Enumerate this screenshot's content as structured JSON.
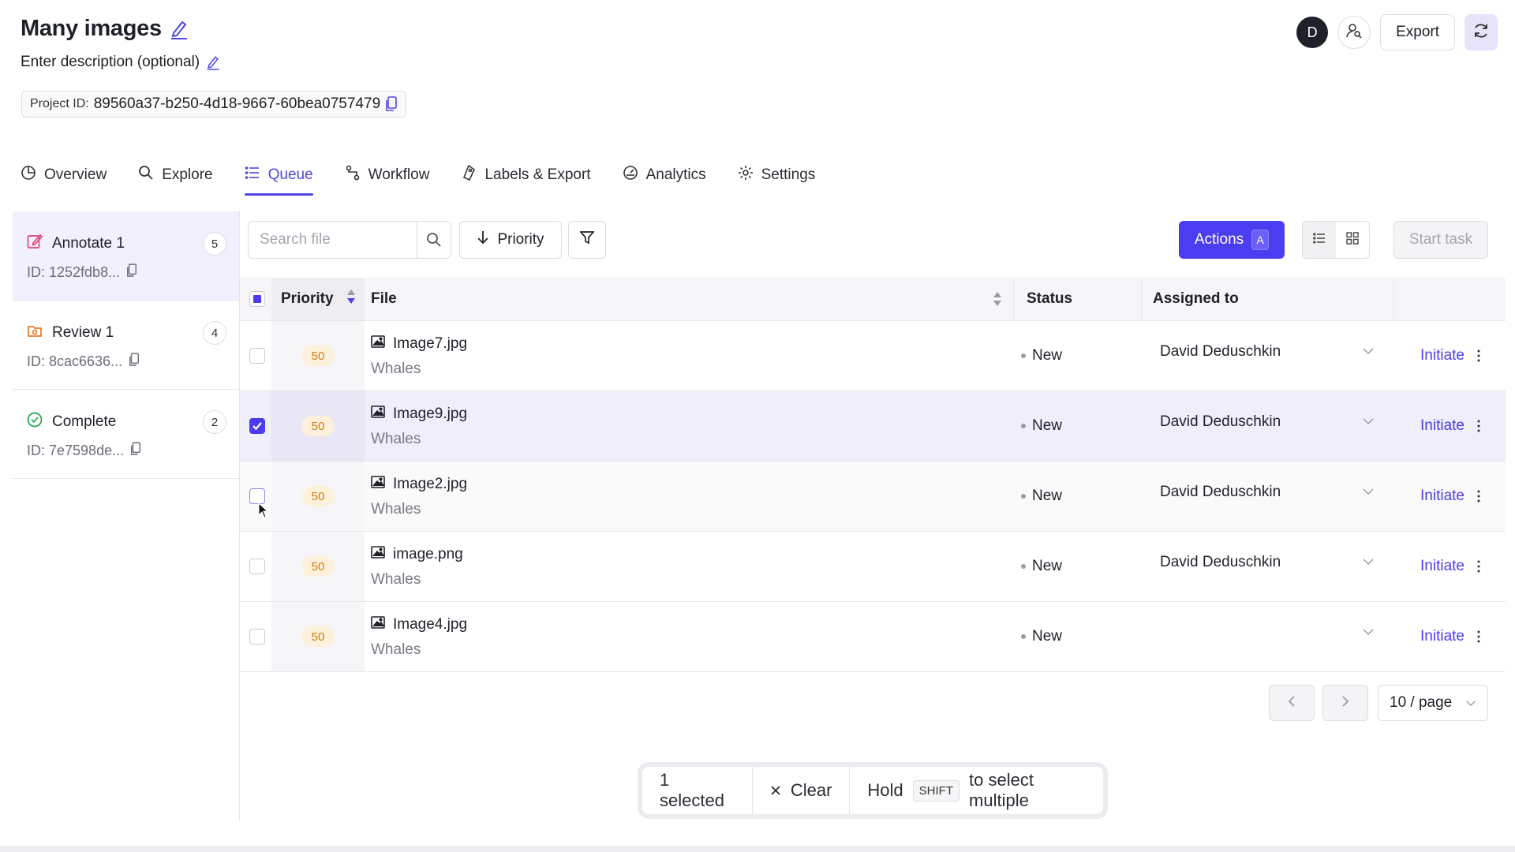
{
  "header": {
    "title": "Many images",
    "description": "Enter description (optional)",
    "project_id_label": "Project ID:",
    "project_id": "89560a37-b250-4d18-9667-60bea0757479",
    "avatar_initial": "D",
    "export_label": "Export"
  },
  "tabs": [
    {
      "label": "Overview",
      "icon": "overview-icon"
    },
    {
      "label": "Explore",
      "icon": "search-icon"
    },
    {
      "label": "Queue",
      "icon": "list-icon",
      "active": true
    },
    {
      "label": "Workflow",
      "icon": "workflow-icon"
    },
    {
      "label": "Labels & Export",
      "icon": "tag-icon"
    },
    {
      "label": "Analytics",
      "icon": "gauge-icon"
    },
    {
      "label": "Settings",
      "icon": "gear-icon"
    }
  ],
  "stages": [
    {
      "name": "Annotate 1",
      "id": "ID: 1252fdb8...",
      "count": "5",
      "icon": "edit-icon",
      "color": "#e0457b"
    },
    {
      "name": "Review 1",
      "id": "ID: 8cac6636...",
      "count": "4",
      "icon": "review-icon",
      "color": "#e07b2a"
    },
    {
      "name": "Complete",
      "id": "ID: 7e7598de...",
      "count": "2",
      "icon": "check-circle-icon",
      "color": "#2aa04a"
    }
  ],
  "toolbar": {
    "search_placeholder": "Search file",
    "sort_label": "Priority",
    "actions_label": "Actions",
    "actions_shortcut": "A",
    "start_task_label": "Start task"
  },
  "table": {
    "columns": {
      "priority": "Priority",
      "file": "File",
      "status": "Status",
      "assigned": "Assigned to"
    },
    "rows": [
      {
        "priority": "50",
        "file": "Image7.jpg",
        "dataset": "Whales",
        "status": "New",
        "assignee": "David Deduschkin",
        "action": "Initiate",
        "selected": false
      },
      {
        "priority": "50",
        "file": "Image9.jpg",
        "dataset": "Whales",
        "status": "New",
        "assignee": "David Deduschkin",
        "action": "Initiate",
        "selected": true
      },
      {
        "priority": "50",
        "file": "Image2.jpg",
        "dataset": "Whales",
        "status": "New",
        "assignee": "David Deduschkin",
        "action": "Initiate",
        "selected": false
      },
      {
        "priority": "50",
        "file": "image.png",
        "dataset": "Whales",
        "status": "New",
        "assignee": "David Deduschkin",
        "action": "Initiate",
        "selected": false
      },
      {
        "priority": "50",
        "file": "Image4.jpg",
        "dataset": "Whales",
        "status": "New",
        "assignee": "",
        "action": "Initiate",
        "selected": false
      }
    ]
  },
  "pagination": {
    "page_size": "10 / page"
  },
  "selection_bar": {
    "count_text": "1 selected",
    "clear_label": "Clear",
    "hold_text": "Hold",
    "key": "SHIFT",
    "tail_text": "to select multiple"
  },
  "colors": {
    "accent": "#4b3df0",
    "priority_badge_bg": "#fdf1dc",
    "priority_badge_text": "#c97a12"
  }
}
